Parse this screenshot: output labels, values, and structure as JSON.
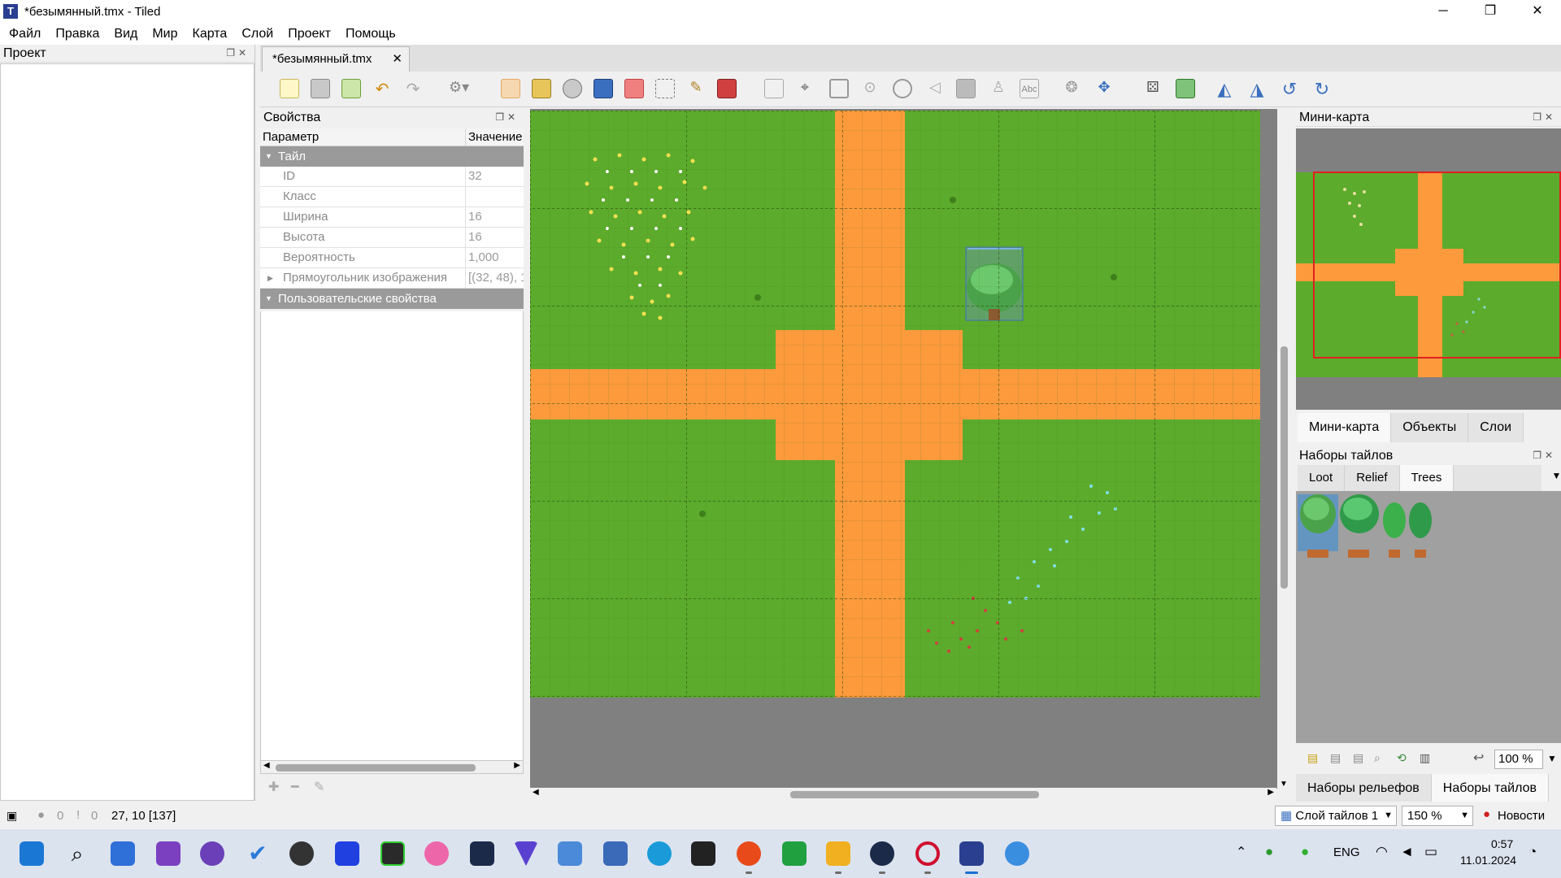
{
  "window": {
    "title": "*безымянный.tmx - Tiled",
    "app_icon": "T",
    "minimize": "─",
    "maximize": "❐",
    "close": "✕"
  },
  "menu": [
    "Файл",
    "Правка",
    "Вид",
    "Мир",
    "Карта",
    "Слой",
    "Проект",
    "Помощь"
  ],
  "project_dock": {
    "title": "Проект"
  },
  "document_tab": {
    "label": "*безымянный.tmx",
    "close": "✕"
  },
  "properties": {
    "title": "Свойства",
    "col_param": "Параметр",
    "col_value": "Значение",
    "group_tile": "Тайл",
    "rows": [
      {
        "key": "ID",
        "value": "32"
      },
      {
        "key": "Класс",
        "value": ""
      },
      {
        "key": "Ширина",
        "value": "16"
      },
      {
        "key": "Высота",
        "value": "16"
      },
      {
        "key": "Вероятность",
        "value": "1,000"
      },
      {
        "key": "Прямоугольник изображения",
        "value": "[(32, 48), 1"
      }
    ],
    "group_custom": "Пользовательские свойства"
  },
  "minimap": {
    "title": "Мини-карта"
  },
  "right_tabs": [
    "Мини-карта",
    "Объекты",
    "Слои"
  ],
  "tilesets": {
    "title": "Наборы тайлов",
    "tabs": [
      "Loot",
      "Relief",
      "Trees"
    ],
    "selected_tab": "Trees",
    "zoom": "100 %"
  },
  "bottom_right_tabs": [
    "Наборы рельефов",
    "Наборы тайлов"
  ],
  "status": {
    "errors": "0",
    "warnings": "0",
    "coords": "27, 10 [137]",
    "layer": "Слой тайлов 1",
    "zoom": "150 %",
    "news": "Новости"
  },
  "taskbar": {
    "lang": "ENG",
    "time": "0:57",
    "date": "11.01.2024"
  },
  "colors": {
    "grass": "#5cab2c",
    "road": "#fd9a3c",
    "selection": "#6a8ed6",
    "minimap_frame": "#e02020"
  }
}
